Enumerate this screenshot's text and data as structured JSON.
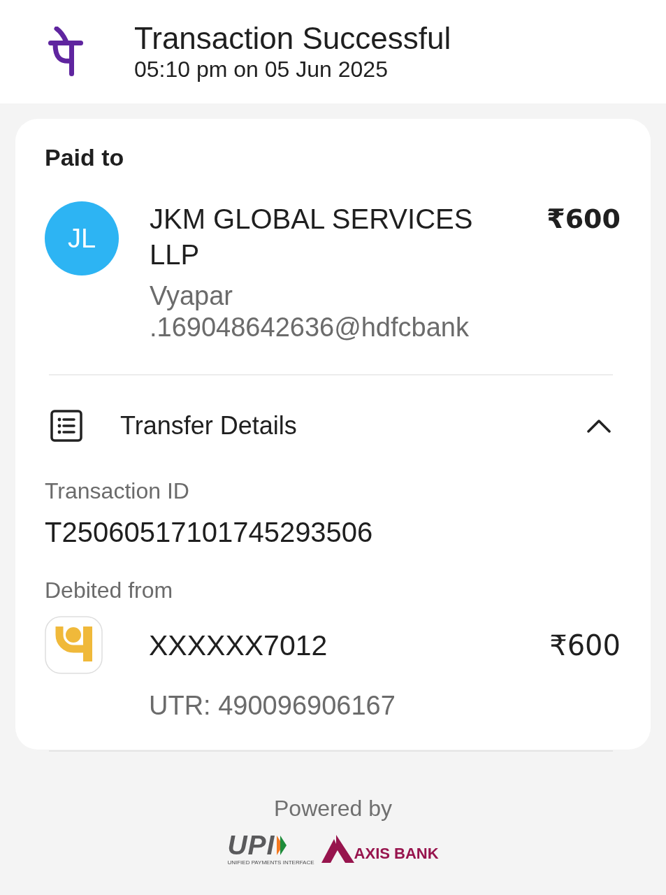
{
  "header": {
    "title": "Transaction Successful",
    "timestamp": "05:10 pm on 05 Jun 2025"
  },
  "paid_to": {
    "heading": "Paid to",
    "avatar_initials": "JL",
    "name": "JKM GLOBAL SERVICES LLP",
    "upi_id": "Vyapar.169048642636@hdfcbank",
    "amount": "₹600"
  },
  "transfer_details": {
    "title": "Transfer Details",
    "expanded": true,
    "transaction_id_label": "Transaction ID",
    "transaction_id": "T25060517101745293506",
    "debited_from_label": "Debited from",
    "account": "XXXXXX7012",
    "amount": "₹600",
    "utr": "UTR: 490096906167"
  },
  "footer": {
    "powered_by": "Powered by",
    "upi_logo_text": "UPI",
    "upi_tagline": "UNIFIED PAYMENTS INTERFACE",
    "bank_name": "AXIS BANK"
  }
}
